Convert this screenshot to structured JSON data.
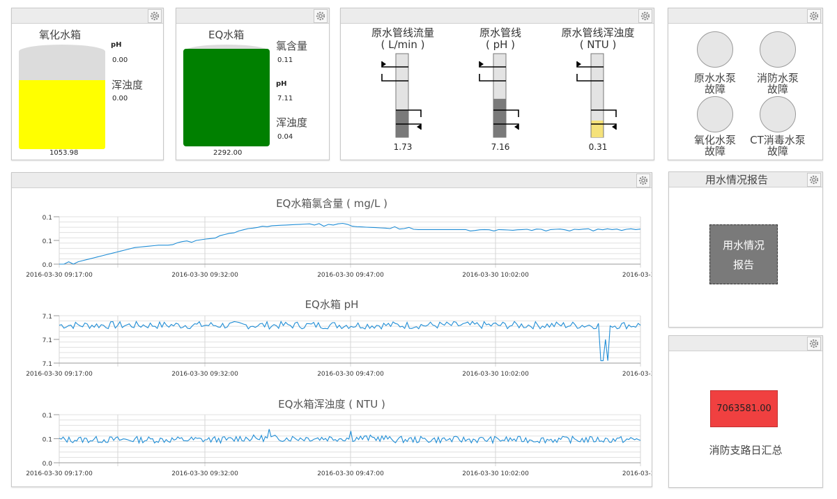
{
  "oxidation_tank": {
    "title": "氧化水箱",
    "ph_label": "pH",
    "ph_value": "0.00",
    "turbidity_label": "浑浊度",
    "turbidity_value": "0.00",
    "level_value": "1053.98",
    "fill_fraction": 0.66,
    "fill_color": "#ffff00"
  },
  "eq_tank": {
    "title": "EQ水箱",
    "chlorine_label": "氯含量",
    "chlorine_value": "0.11",
    "ph_label": "pH",
    "ph_value": "7.11",
    "turbidity_label": "浑浊度",
    "turbidity_value": "0.04",
    "level_value": "2292.00",
    "fill_fraction": 0.96,
    "fill_color": "#008000"
  },
  "gauges": [
    {
      "title_line1": "原水管线流量",
      "title_line2": "( L/min )",
      "value": "1.73",
      "fill_fraction": 0.32,
      "fill_color": "#7a7a7a"
    },
    {
      "title_line1": "原水管线",
      "title_line2": "( pH )",
      "value": "7.16",
      "fill_fraction": 0.46,
      "fill_color": "#7a7a7a"
    },
    {
      "title_line1": "原水管线浑浊度",
      "title_line2": "( NTU )",
      "value": "0.31",
      "fill_fraction": 0.2,
      "fill_color": "#f5e27a"
    }
  ],
  "pumps": [
    {
      "line1": "原水水泵",
      "line2": "故障"
    },
    {
      "line1": "消防水泵",
      "line2": "故障"
    },
    {
      "line1": "氧化水泵",
      "line2": "故障"
    },
    {
      "line1": "CT消毒水泵",
      "line2": "故障"
    }
  ],
  "report_panel": {
    "title": "用水情况报告",
    "button_line1": "用水情况",
    "button_line2": "报告"
  },
  "fire_panel": {
    "value": "7063581.00",
    "label": "消防支路日汇总"
  },
  "chart_data": [
    {
      "type": "line",
      "title": "EQ水箱氯含量 ( mg/L )",
      "y_tick_labels": [
        "0.1",
        "0.1",
        "0.0"
      ],
      "x_tick_labels": [
        "2016-03-30 09:17:00",
        "2016-03-30 09:32:00",
        "2016-03-30 09:47:00",
        "2016-03-30 10:02:00",
        "2016-03-30"
      ],
      "line_color": "#1f8dd6",
      "grid": true,
      "series": [
        {
          "values": [
            0.0,
            0.0,
            0.01,
            0.0,
            0.01,
            0.015,
            0.02,
            0.025,
            0.03,
            0.035,
            0.04,
            0.045,
            0.05,
            0.055,
            0.06,
            0.065,
            0.07,
            0.072,
            0.074,
            0.076,
            0.078,
            0.08,
            0.08,
            0.08,
            0.082,
            0.09,
            0.095,
            0.098,
            0.092,
            0.1,
            0.103,
            0.106,
            0.108,
            0.11,
            0.12,
            0.125,
            0.13,
            0.132,
            0.14,
            0.145,
            0.15,
            0.152,
            0.155,
            0.16,
            0.158,
            0.162,
            0.163,
            0.164,
            0.165,
            0.166,
            0.167,
            0.168,
            0.169,
            0.17,
            0.165,
            0.171,
            0.16,
            0.168,
            0.165,
            0.17,
            0.172,
            0.168,
            0.16,
            0.158,
            0.157,
            0.156,
            0.155,
            0.154,
            0.153,
            0.152,
            0.15,
            0.158,
            0.148,
            0.15,
            0.155,
            0.147,
            0.146,
            0.146,
            0.146,
            0.146,
            0.146,
            0.146,
            0.146,
            0.146,
            0.146,
            0.146,
            0.146,
            0.14,
            0.142,
            0.145,
            0.146,
            0.145,
            0.14,
            0.146,
            0.145,
            0.144,
            0.143,
            0.145,
            0.146,
            0.147,
            0.142,
            0.148,
            0.147,
            0.14,
            0.146,
            0.147,
            0.148,
            0.145,
            0.14,
            0.147,
            0.146,
            0.148,
            0.149,
            0.14,
            0.148,
            0.145,
            0.149,
            0.146,
            0.148,
            0.142,
            0.147,
            0.149,
            0.146,
            0.148
          ]
        }
      ]
    },
    {
      "type": "line",
      "title": "EQ水箱 pH",
      "y_tick_labels": [
        "7.1",
        "7.1",
        "7.1"
      ],
      "x_tick_labels": [
        "2016-03-30 09:17:00",
        "2016-03-30 09:32:00",
        "2016-03-30 09:47:00",
        "2016-03-30 10:02:00",
        "2016-03-30"
      ],
      "line_color": "#1f8dd6",
      "grid": true,
      "series": [
        {
          "values": []
        }
      ]
    },
    {
      "type": "line",
      "title": "EQ水箱浑浊度 ( NTU )",
      "y_tick_labels": [
        "0.1",
        "0.1",
        "0.0"
      ],
      "x_tick_labels": [
        "2016-03-30 09:17:00",
        "2016-03-30 09:32:00",
        "2016-03-30 09:47:00",
        "2016-03-30 10:02:00",
        "2016-03-30"
      ],
      "line_color": "#1f8dd6",
      "grid": true,
      "series": [
        {
          "values": []
        }
      ]
    }
  ]
}
